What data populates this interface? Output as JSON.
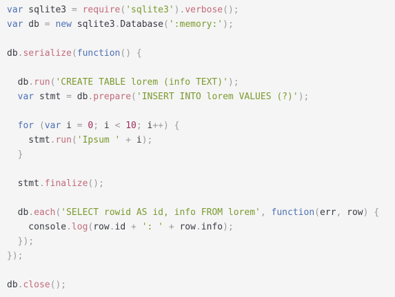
{
  "code": {
    "lines": [
      [
        {
          "t": "var",
          "c": "kw"
        },
        {
          "t": " sqlite3 ",
          "c": "id"
        },
        {
          "t": "=",
          "c": "op"
        },
        {
          "t": " ",
          "c": "id"
        },
        {
          "t": "require",
          "c": "fn"
        },
        {
          "t": "(",
          "c": "punc"
        },
        {
          "t": "'sqlite3'",
          "c": "str"
        },
        {
          "t": ").",
          "c": "punc"
        },
        {
          "t": "verbose",
          "c": "fn"
        },
        {
          "t": "();",
          "c": "punc"
        }
      ],
      [
        {
          "t": "var",
          "c": "kw"
        },
        {
          "t": " db ",
          "c": "id"
        },
        {
          "t": "=",
          "c": "op"
        },
        {
          "t": " ",
          "c": "id"
        },
        {
          "t": "new",
          "c": "kw"
        },
        {
          "t": " sqlite3",
          "c": "id"
        },
        {
          "t": ".",
          "c": "punc"
        },
        {
          "t": "Database",
          "c": "id"
        },
        {
          "t": "(",
          "c": "punc"
        },
        {
          "t": "':memory:'",
          "c": "str"
        },
        {
          "t": ");",
          "c": "punc"
        }
      ],
      [],
      [
        {
          "t": "db",
          "c": "id"
        },
        {
          "t": ".",
          "c": "punc"
        },
        {
          "t": "serialize",
          "c": "fn"
        },
        {
          "t": "(",
          "c": "punc"
        },
        {
          "t": "function",
          "c": "kw"
        },
        {
          "t": "() {",
          "c": "punc"
        }
      ],
      [],
      [
        {
          "t": "  db",
          "c": "id"
        },
        {
          "t": ".",
          "c": "punc"
        },
        {
          "t": "run",
          "c": "fn"
        },
        {
          "t": "(",
          "c": "punc"
        },
        {
          "t": "'CREATE TABLE lorem (info TEXT)'",
          "c": "str"
        },
        {
          "t": ");",
          "c": "punc"
        }
      ],
      [
        {
          "t": "  ",
          "c": "id"
        },
        {
          "t": "var",
          "c": "kw"
        },
        {
          "t": " stmt ",
          "c": "id"
        },
        {
          "t": "=",
          "c": "op"
        },
        {
          "t": " db",
          "c": "id"
        },
        {
          "t": ".",
          "c": "punc"
        },
        {
          "t": "prepare",
          "c": "fn"
        },
        {
          "t": "(",
          "c": "punc"
        },
        {
          "t": "'INSERT INTO lorem VALUES (?)'",
          "c": "str"
        },
        {
          "t": ");",
          "c": "punc"
        }
      ],
      [],
      [
        {
          "t": "  ",
          "c": "id"
        },
        {
          "t": "for",
          "c": "kw"
        },
        {
          "t": " (",
          "c": "punc"
        },
        {
          "t": "var",
          "c": "kw"
        },
        {
          "t": " i ",
          "c": "id"
        },
        {
          "t": "=",
          "c": "op"
        },
        {
          "t": " ",
          "c": "id"
        },
        {
          "t": "0",
          "c": "num"
        },
        {
          "t": "; ",
          "c": "punc"
        },
        {
          "t": "i ",
          "c": "id"
        },
        {
          "t": "<",
          "c": "op"
        },
        {
          "t": " ",
          "c": "id"
        },
        {
          "t": "10",
          "c": "num"
        },
        {
          "t": "; ",
          "c": "punc"
        },
        {
          "t": "i",
          "c": "id"
        },
        {
          "t": "++",
          "c": "op"
        },
        {
          "t": ") {",
          "c": "punc"
        }
      ],
      [
        {
          "t": "    stmt",
          "c": "id"
        },
        {
          "t": ".",
          "c": "punc"
        },
        {
          "t": "run",
          "c": "fn"
        },
        {
          "t": "(",
          "c": "punc"
        },
        {
          "t": "'Ipsum '",
          "c": "str"
        },
        {
          "t": " ",
          "c": "id"
        },
        {
          "t": "+",
          "c": "op"
        },
        {
          "t": " i",
          "c": "id"
        },
        {
          "t": ");",
          "c": "punc"
        }
      ],
      [
        {
          "t": "  }",
          "c": "punc"
        }
      ],
      [],
      [
        {
          "t": "  stmt",
          "c": "id"
        },
        {
          "t": ".",
          "c": "punc"
        },
        {
          "t": "finalize",
          "c": "fn"
        },
        {
          "t": "();",
          "c": "punc"
        }
      ],
      [],
      [
        {
          "t": "  db",
          "c": "id"
        },
        {
          "t": ".",
          "c": "punc"
        },
        {
          "t": "each",
          "c": "fn"
        },
        {
          "t": "(",
          "c": "punc"
        },
        {
          "t": "'SELECT rowid AS id, info FROM lorem'",
          "c": "str"
        },
        {
          "t": ", ",
          "c": "punc"
        },
        {
          "t": "function",
          "c": "kw"
        },
        {
          "t": "(",
          "c": "punc"
        },
        {
          "t": "err",
          "c": "id"
        },
        {
          "t": ", ",
          "c": "punc"
        },
        {
          "t": "row",
          "c": "id"
        },
        {
          "t": ") {",
          "c": "punc"
        }
      ],
      [
        {
          "t": "    console",
          "c": "id"
        },
        {
          "t": ".",
          "c": "punc"
        },
        {
          "t": "log",
          "c": "fn"
        },
        {
          "t": "(",
          "c": "punc"
        },
        {
          "t": "row",
          "c": "id"
        },
        {
          "t": ".",
          "c": "punc"
        },
        {
          "t": "id ",
          "c": "id"
        },
        {
          "t": "+",
          "c": "op"
        },
        {
          "t": " ",
          "c": "id"
        },
        {
          "t": "': '",
          "c": "str"
        },
        {
          "t": " ",
          "c": "id"
        },
        {
          "t": "+",
          "c": "op"
        },
        {
          "t": " row",
          "c": "id"
        },
        {
          "t": ".",
          "c": "punc"
        },
        {
          "t": "info",
          "c": "id"
        },
        {
          "t": ");",
          "c": "punc"
        }
      ],
      [
        {
          "t": "  });",
          "c": "punc"
        }
      ],
      [
        {
          "t": "});",
          "c": "punc"
        }
      ],
      [],
      [
        {
          "t": "db",
          "c": "id"
        },
        {
          "t": ".",
          "c": "punc"
        },
        {
          "t": "close",
          "c": "fn"
        },
        {
          "t": "();",
          "c": "punc"
        }
      ]
    ]
  },
  "colors": {
    "background": "#f5f5f5",
    "keyword": "#4c6fb5",
    "function": "#c26a7a",
    "string": "#7a9a2e",
    "number": "#a0295a",
    "punctuation": "#9a9a9a",
    "identifier": "#383a42"
  }
}
